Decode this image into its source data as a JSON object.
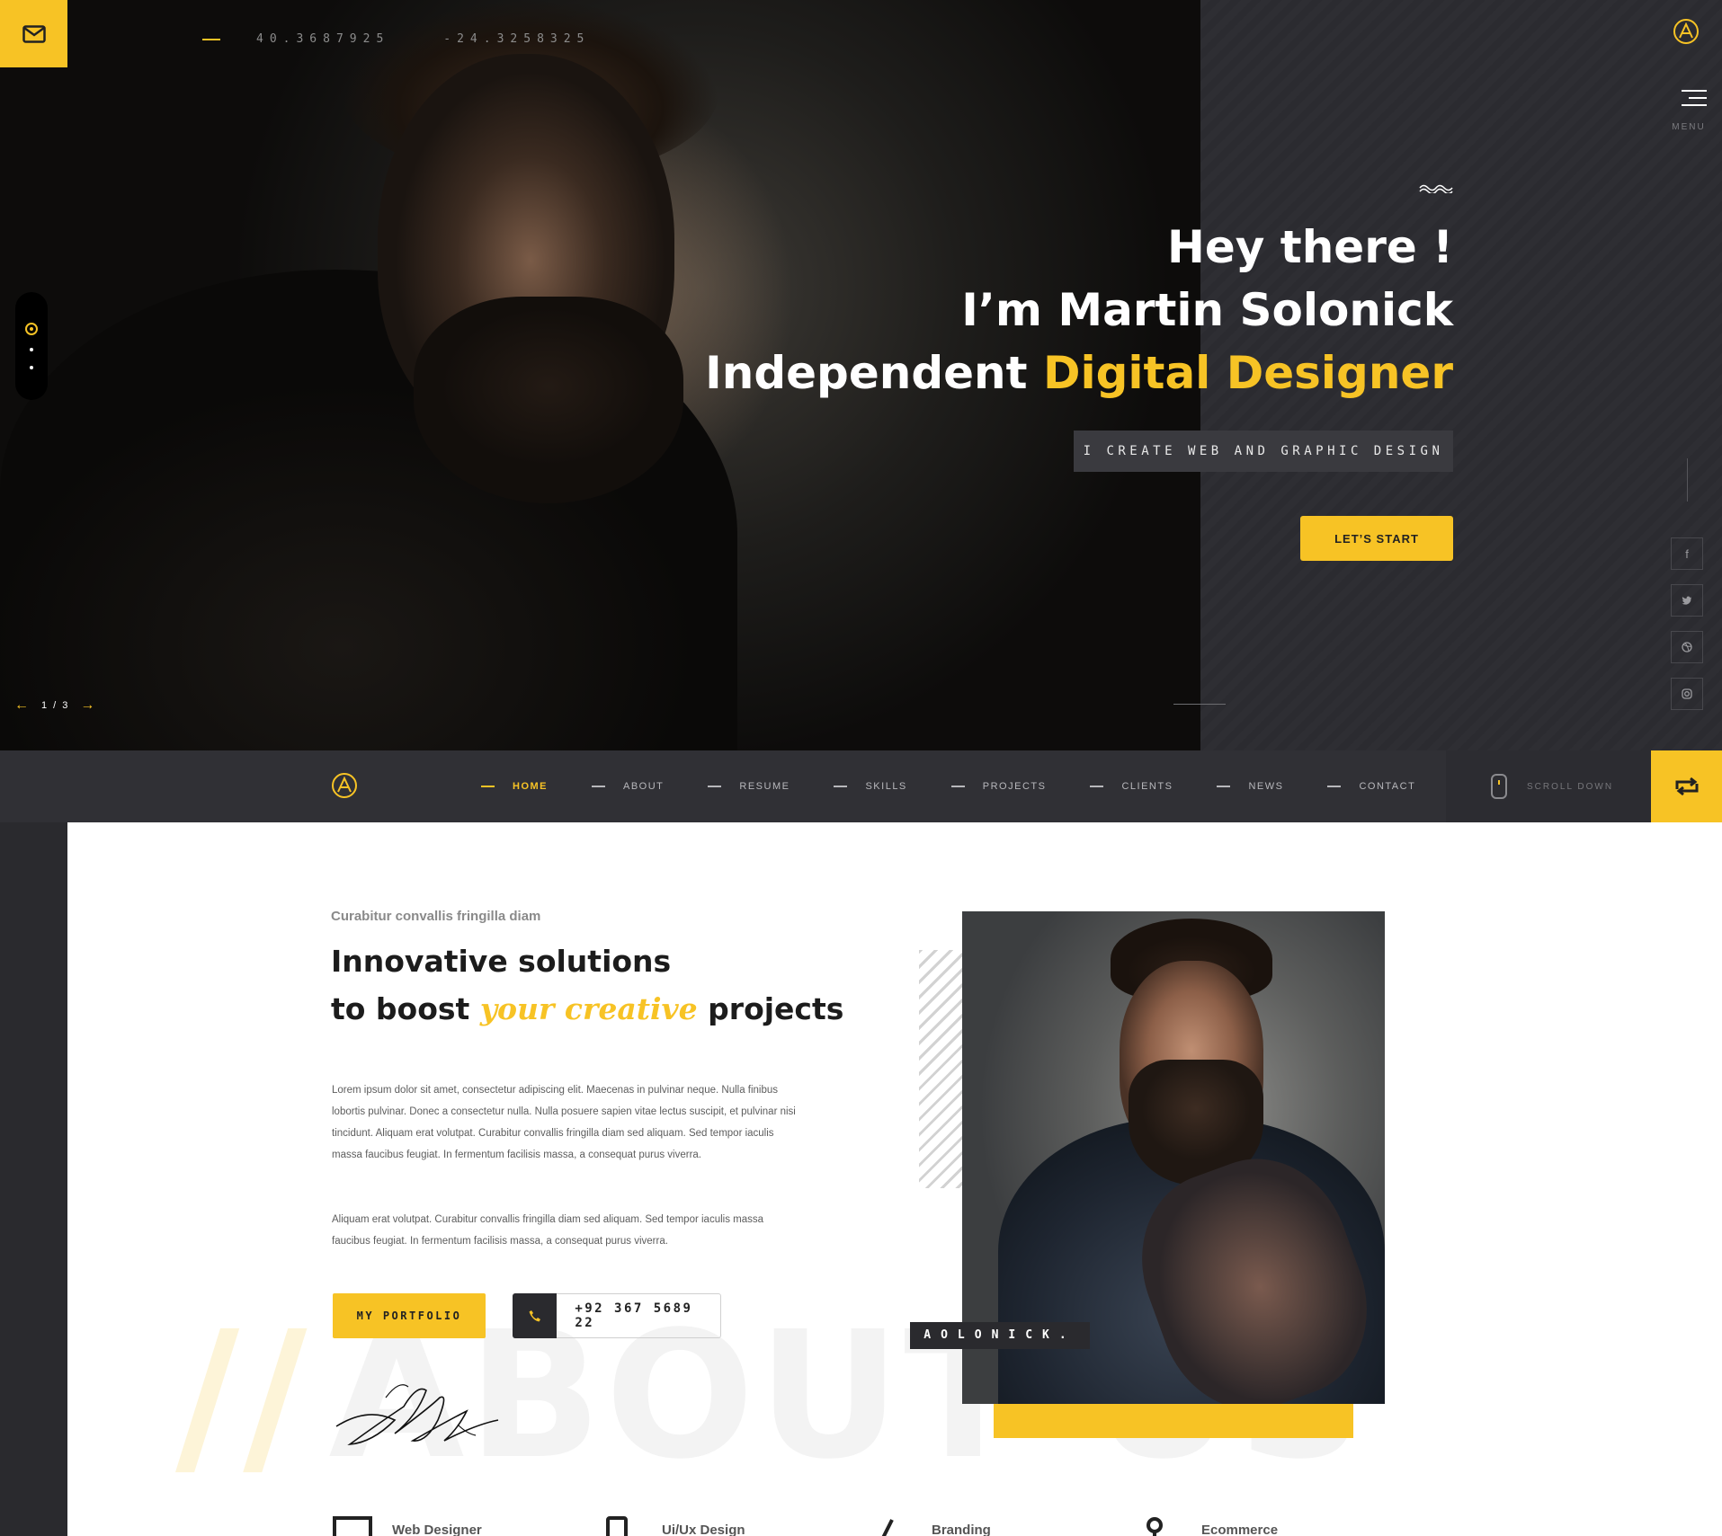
{
  "hero": {
    "coord_lat": "40.3687925",
    "coord_lng": "-24.3258325",
    "menu_label": "MENU",
    "greeting": "Hey there !",
    "name_line": "I’m Martin Solonick",
    "title_prefix": "Independent ",
    "title_highlight": "Digital Designer",
    "tagline": "I CREATE WEB AND GRAPHIC DESIGN",
    "cta": "LET’S START",
    "slide_counter": "1 / 3",
    "social": [
      "f",
      "t",
      "d",
      "i"
    ]
  },
  "nav": {
    "items": [
      {
        "label": "HOME",
        "active": true
      },
      {
        "label": "ABOUT",
        "active": false
      },
      {
        "label": "RESUME",
        "active": false
      },
      {
        "label": "SKILLS",
        "active": false
      },
      {
        "label": "PROJECTS",
        "active": false
      },
      {
        "label": "CLIENTS",
        "active": false
      },
      {
        "label": "NEWS",
        "active": false
      },
      {
        "label": "CONTACT",
        "active": false
      }
    ],
    "scroll_label": "SCROLL DOWN"
  },
  "about": {
    "eyebrow": "Curabitur convallis fringilla diam",
    "headline_1": "Innovative solutions",
    "headline_2_pre": "to boost ",
    "headline_2_hl": "your creative",
    "headline_2_post": " projects",
    "paragraph_1": "Lorem ipsum dolor sit amet, consectetur adipiscing elit. Maecenas in pulvinar neque. Nulla finibus lobortis pulvinar. Donec a consectetur nulla. Nulla posuere sapien vitae lectus suscipit, et pulvinar nisi tincidunt. Aliquam erat volutpat. Curabitur convallis fringilla diam sed aliquam. Sed tempor iaculis massa faucibus feugiat. In fermentum facilisis massa, a consequat purus viverra.",
    "paragraph_2": "Aliquam erat volutpat. Curabitur convallis fringilla diam sed aliquam. Sed tempor iaculis massa faucibus feugiat. In fermentum facilisis massa, a consequat purus viverra.",
    "portfolio_btn": "MY PORTFOLIO",
    "phone": "+92 367 5689 22",
    "name_tag": "AOLONICK.",
    "bg_slashes": "//",
    "bg_word": "ABOUT US",
    "services": [
      "Web Designer",
      "Ui/Ux Design",
      "Branding",
      "Ecommerce"
    ]
  },
  "colors": {
    "accent": "#f7c325",
    "dark": "#2a2a2e"
  }
}
